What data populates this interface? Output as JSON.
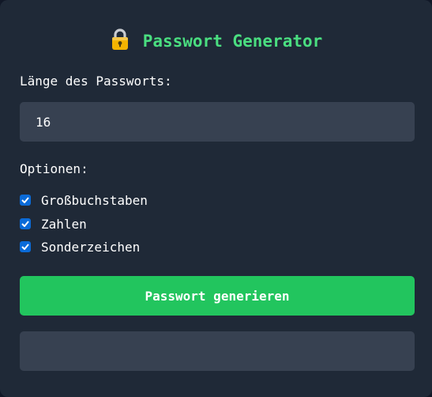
{
  "app": {
    "title": "Passwort Generator",
    "title_icon": "lock-icon",
    "accent_color": "#4ade80",
    "button_color": "#22c55e"
  },
  "length": {
    "label": "Länge des Passworts:",
    "value": "16"
  },
  "options": {
    "label": "Optionen:",
    "items": [
      {
        "label": "Großbuchstaben",
        "checked": true
      },
      {
        "label": "Zahlen",
        "checked": true
      },
      {
        "label": "Sonderzeichen",
        "checked": true
      }
    ]
  },
  "generate_button": {
    "label": "Passwort generieren"
  },
  "result": {
    "value": ""
  }
}
